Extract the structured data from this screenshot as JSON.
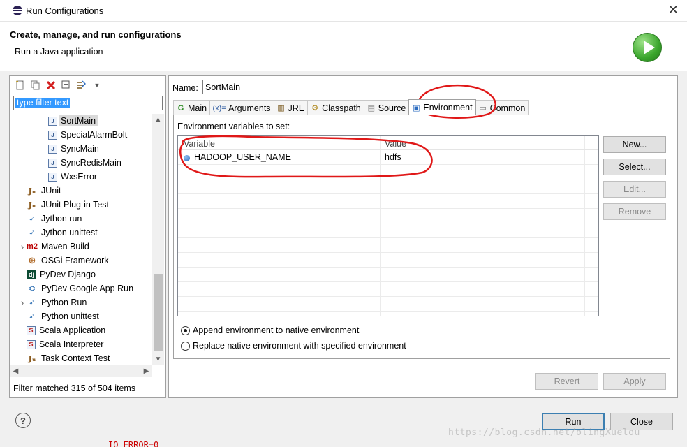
{
  "window": {
    "title": "Run Configurations"
  },
  "banner": {
    "heading": "Create, manage, and run configurations",
    "subtitle": "Run a Java application"
  },
  "left": {
    "filter_placeholder": "type filter text",
    "tree": [
      {
        "label": "SortMain",
        "icon": "java-class-icon",
        "indent": 2,
        "selected": true
      },
      {
        "label": "SpecialAlarmBolt",
        "icon": "java-class-icon",
        "indent": 2
      },
      {
        "label": "SyncMain",
        "icon": "java-class-icon",
        "indent": 2
      },
      {
        "label": "SyncRedisMain",
        "icon": "java-class-icon",
        "indent": 2
      },
      {
        "label": "WxsError",
        "icon": "java-class-icon",
        "indent": 2
      },
      {
        "label": "JUnit",
        "icon": "junit-icon",
        "indent": 1
      },
      {
        "label": "JUnit Plug-in Test",
        "icon": "junit-plugin-icon",
        "indent": 1
      },
      {
        "label": "Jython run",
        "icon": "jython-icon",
        "indent": 1
      },
      {
        "label": "Jython unittest",
        "icon": "jython-unittest-icon",
        "indent": 1
      },
      {
        "label": "Maven Build",
        "icon": "maven-icon",
        "indent": 1,
        "expandable": true
      },
      {
        "label": "OSGi Framework",
        "icon": "osgi-icon",
        "indent": 1
      },
      {
        "label": "PyDev Django",
        "icon": "django-icon",
        "indent": 1
      },
      {
        "label": "PyDev Google App Run",
        "icon": "google-app-icon",
        "indent": 1
      },
      {
        "label": "Python Run",
        "icon": "python-icon",
        "indent": 1,
        "expandable": true
      },
      {
        "label": "Python unittest",
        "icon": "python-unittest-icon",
        "indent": 1
      },
      {
        "label": "Scala Application",
        "icon": "scala-icon",
        "indent": 1
      },
      {
        "label": "Scala Interpreter",
        "icon": "scala-icon",
        "indent": 1
      },
      {
        "label": "Task Context Test",
        "icon": "task-context-icon",
        "indent": 1
      }
    ],
    "filter_status": "Filter matched 315 of 504 items"
  },
  "right": {
    "name_label": "Name:",
    "name_value": "SortMain",
    "tabs": [
      {
        "label": "Main",
        "icon": "main-tab-icon"
      },
      {
        "label": "Arguments",
        "icon": "arguments-icon"
      },
      {
        "label": "JRE",
        "icon": "jre-icon"
      },
      {
        "label": "Classpath",
        "icon": "classpath-icon"
      },
      {
        "label": "Source",
        "icon": "source-icon"
      },
      {
        "label": "Environment",
        "icon": "environment-icon",
        "active": true
      },
      {
        "label": "Common",
        "icon": "common-icon"
      }
    ],
    "env_label": "Environment variables to set:",
    "columns": {
      "variable": "Variable",
      "value": "Value"
    },
    "rows": [
      {
        "variable": "HADOOP_USER_NAME",
        "value": "hdfs"
      }
    ],
    "buttons": {
      "new": "New...",
      "select": "Select...",
      "edit": "Edit...",
      "remove": "Remove"
    },
    "radio_append": "Append environment to native environment",
    "radio_replace": "Replace native environment with specified environment",
    "append_selected": true,
    "revert": "Revert",
    "apply": "Apply"
  },
  "dialog": {
    "run": "Run",
    "close": "Close",
    "help": "?"
  },
  "watermark": "https://blog.csdn.net/olingXuelou",
  "background_text": "IO_ERROR=0",
  "colors": {
    "accent": "#3399ff",
    "annotation": "#e01818",
    "run_green": "#3aa62c"
  }
}
